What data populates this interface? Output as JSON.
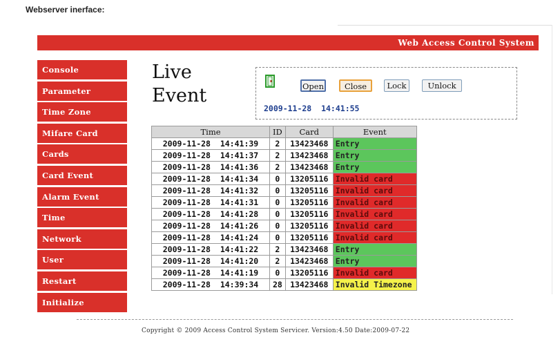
{
  "caption": "Webserver inerface:",
  "app_title": "Web Access Control System",
  "nav": [
    "Console",
    "Parameter",
    "Time Zone",
    "Mifare Card",
    "Cards",
    "Card Event",
    "Alarm Event",
    "Time",
    "Network",
    "User",
    "Restart",
    "Initialize"
  ],
  "heading": {
    "line1": "Live",
    "line2": "Event"
  },
  "controls": {
    "open": "Open",
    "close": "Close",
    "lock": "Lock",
    "unlock": "Unlock",
    "datetime": "2009-11-28  14:41:55"
  },
  "table": {
    "headers": [
      "Time",
      "ID",
      "Card",
      "Event"
    ],
    "rows": [
      {
        "time": "2009-11-28  14:41:39",
        "id": "2",
        "card": "13423468",
        "event": "Entry",
        "status": "entry"
      },
      {
        "time": "2009-11-28  14:41:37",
        "id": "2",
        "card": "13423468",
        "event": "Entry",
        "status": "entry"
      },
      {
        "time": "2009-11-28  14:41:36",
        "id": "2",
        "card": "13423468",
        "event": "Entry",
        "status": "entry"
      },
      {
        "time": "2009-11-28  14:41:34",
        "id": "0",
        "card": "13205116",
        "event": "Invalid card",
        "status": "invalid"
      },
      {
        "time": "2009-11-28  14:41:32",
        "id": "0",
        "card": "13205116",
        "event": "Invalid card",
        "status": "invalid"
      },
      {
        "time": "2009-11-28  14:41:31",
        "id": "0",
        "card": "13205116",
        "event": "Invalid card",
        "status": "invalid"
      },
      {
        "time": "2009-11-28  14:41:28",
        "id": "0",
        "card": "13205116",
        "event": "Invalid card",
        "status": "invalid"
      },
      {
        "time": "2009-11-28  14:41:26",
        "id": "0",
        "card": "13205116",
        "event": "Invalid card",
        "status": "invalid"
      },
      {
        "time": "2009-11-28  14:41:24",
        "id": "0",
        "card": "13205116",
        "event": "Invalid card",
        "status": "invalid"
      },
      {
        "time": "2009-11-28  14:41:22",
        "id": "2",
        "card": "13423468",
        "event": "Entry",
        "status": "entry"
      },
      {
        "time": "2009-11-28  14:41:20",
        "id": "2",
        "card": "13423468",
        "event": "Entry",
        "status": "entry"
      },
      {
        "time": "2009-11-28  14:41:19",
        "id": "0",
        "card": "13205116",
        "event": "Invalid card",
        "status": "invalid"
      },
      {
        "time": "2009-11-28  14:39:34",
        "id": "28",
        "card": "13423468",
        "event": "Invalid Timezone",
        "status": "tz"
      }
    ]
  },
  "status_colors": {
    "entry": "#5cc65c",
    "invalid": "#e02a2a",
    "tz": "#f5f24a",
    "brand": "#d9302a"
  },
  "footer": "Copyright © 2009 Access Control System Servicer. Version:4.50 Date:2009-07-22"
}
